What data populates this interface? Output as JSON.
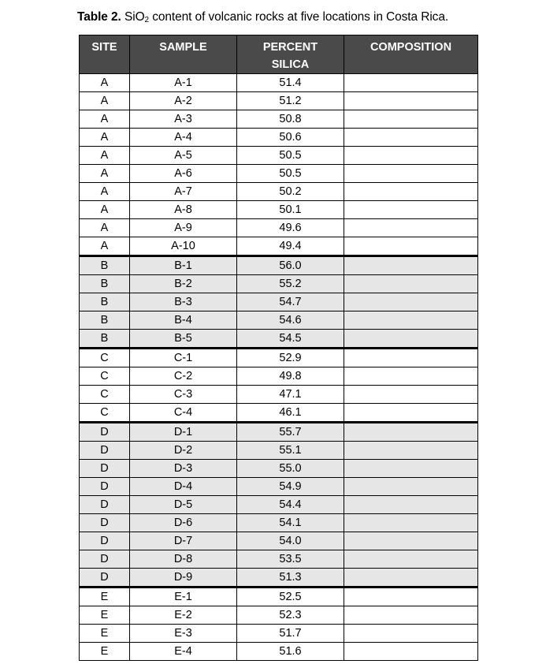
{
  "caption": {
    "label": "Table 2.",
    "text_before_sub": " SiO",
    "subscript": "2",
    "text_after_sub": " content of volcanic rocks at five locations in Costa Rica."
  },
  "table": {
    "headers": [
      "SITE",
      "SAMPLE",
      "PERCENT SILICA",
      "COMPOSITION"
    ],
    "header_lines": {
      "percent_silica_line1": "PERCENT",
      "percent_silica_line2": "SILICA"
    },
    "colors": {
      "header_bg": "#4a4a4a",
      "header_text": "#ffffff",
      "shaded_row": "#e6e6e6"
    },
    "rows": [
      {
        "site": "A",
        "sample": "A-1",
        "silica": "51.4",
        "composition": "",
        "shaded": false,
        "group_start": false
      },
      {
        "site": "A",
        "sample": "A-2",
        "silica": "51.2",
        "composition": "",
        "shaded": false,
        "group_start": false
      },
      {
        "site": "A",
        "sample": "A-3",
        "silica": "50.8",
        "composition": "",
        "shaded": false,
        "group_start": false
      },
      {
        "site": "A",
        "sample": "A-4",
        "silica": "50.6",
        "composition": "",
        "shaded": false,
        "group_start": false
      },
      {
        "site": "A",
        "sample": "A-5",
        "silica": "50.5",
        "composition": "",
        "shaded": false,
        "group_start": false
      },
      {
        "site": "A",
        "sample": "A-6",
        "silica": "50.5",
        "composition": "",
        "shaded": false,
        "group_start": false
      },
      {
        "site": "A",
        "sample": "A-7",
        "silica": "50.2",
        "composition": "",
        "shaded": false,
        "group_start": false
      },
      {
        "site": "A",
        "sample": "A-8",
        "silica": "50.1",
        "composition": "",
        "shaded": false,
        "group_start": false
      },
      {
        "site": "A",
        "sample": "A-9",
        "silica": "49.6",
        "composition": "",
        "shaded": false,
        "group_start": false
      },
      {
        "site": "A",
        "sample": "A-10",
        "silica": "49.4",
        "composition": "",
        "shaded": false,
        "group_start": false
      },
      {
        "site": "B",
        "sample": "B-1",
        "silica": "56.0",
        "composition": "",
        "shaded": true,
        "group_start": true
      },
      {
        "site": "B",
        "sample": "B-2",
        "silica": "55.2",
        "composition": "",
        "shaded": true,
        "group_start": false
      },
      {
        "site": "B",
        "sample": "B-3",
        "silica": "54.7",
        "composition": "",
        "shaded": true,
        "group_start": false
      },
      {
        "site": "B",
        "sample": "B-4",
        "silica": "54.6",
        "composition": "",
        "shaded": true,
        "group_start": false
      },
      {
        "site": "B",
        "sample": "B-5",
        "silica": "54.5",
        "composition": "",
        "shaded": true,
        "group_start": false
      },
      {
        "site": "C",
        "sample": "C-1",
        "silica": "52.9",
        "composition": "",
        "shaded": false,
        "group_start": true
      },
      {
        "site": "C",
        "sample": "C-2",
        "silica": "49.8",
        "composition": "",
        "shaded": false,
        "group_start": false
      },
      {
        "site": "C",
        "sample": "C-3",
        "silica": "47.1",
        "composition": "",
        "shaded": false,
        "group_start": false
      },
      {
        "site": "C",
        "sample": "C-4",
        "silica": "46.1",
        "composition": "",
        "shaded": false,
        "group_start": false
      },
      {
        "site": "D",
        "sample": "D-1",
        "silica": "55.7",
        "composition": "",
        "shaded": true,
        "group_start": true
      },
      {
        "site": "D",
        "sample": "D-2",
        "silica": "55.1",
        "composition": "",
        "shaded": true,
        "group_start": false
      },
      {
        "site": "D",
        "sample": "D-3",
        "silica": "55.0",
        "composition": "",
        "shaded": true,
        "group_start": false
      },
      {
        "site": "D",
        "sample": "D-4",
        "silica": "54.9",
        "composition": "",
        "shaded": true,
        "group_start": false
      },
      {
        "site": "D",
        "sample": "D-5",
        "silica": "54.4",
        "composition": "",
        "shaded": true,
        "group_start": false
      },
      {
        "site": "D",
        "sample": "D-6",
        "silica": "54.1",
        "composition": "",
        "shaded": true,
        "group_start": false
      },
      {
        "site": "D",
        "sample": "D-7",
        "silica": "54.0",
        "composition": "",
        "shaded": true,
        "group_start": false
      },
      {
        "site": "D",
        "sample": "D-8",
        "silica": "53.5",
        "composition": "",
        "shaded": true,
        "group_start": false
      },
      {
        "site": "D",
        "sample": "D-9",
        "silica": "51.3",
        "composition": "",
        "shaded": true,
        "group_start": false
      },
      {
        "site": "E",
        "sample": "E-1",
        "silica": "52.5",
        "composition": "",
        "shaded": false,
        "group_start": true
      },
      {
        "site": "E",
        "sample": "E-2",
        "silica": "52.3",
        "composition": "",
        "shaded": false,
        "group_start": false
      },
      {
        "site": "E",
        "sample": "E-3",
        "silica": "51.7",
        "composition": "",
        "shaded": false,
        "group_start": false
      },
      {
        "site": "E",
        "sample": "E-4",
        "silica": "51.6",
        "composition": "",
        "shaded": false,
        "group_start": false
      }
    ]
  }
}
